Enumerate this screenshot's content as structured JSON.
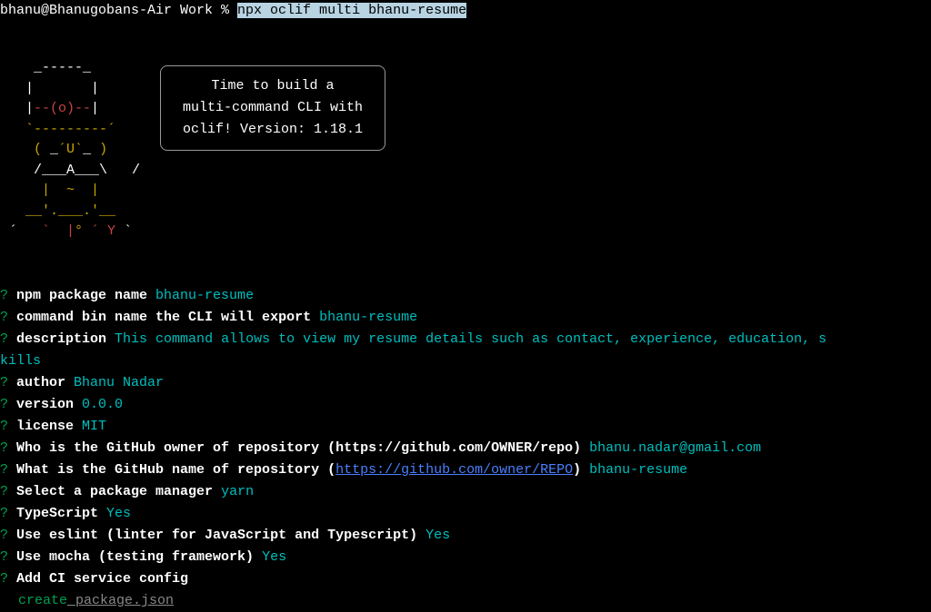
{
  "prompt": {
    "host": "bhanu@Bhanugobans-Air Work % ",
    "command": "npx oclif multi bhanu-resume"
  },
  "ascii": {
    "l1": "   _-----_     ",
    "l2a": "  |       |    ",
    "l2b": "",
    "l3a": "  |",
    "l3b": "--(o)--",
    "l3c": "|    ",
    "l4": "  `---------´   ",
    "l5a": "   ",
    "l5b": "( ",
    "l5c": "_",
    "l5d": "´U`",
    "l5e": "_",
    "l5f": " )",
    "l5g": "    ",
    "l6": "   /___A___\\   /",
    "l7a": "    ",
    "l7b": "|  ~  |",
    "l7c": "     ",
    "l8": "  __'.___.'__   ",
    "l9a": "´   ",
    "l9b": "`  |",
    "l9c": "° ",
    "l9d": "´ Y",
    "l9e": " ` "
  },
  "speech": {
    "line1": "Time to build a",
    "line2": "multi-command CLI with",
    "line3": "oclif! Version: 1.18.1"
  },
  "questions": {
    "mark": "?",
    "q1": {
      "text": " npm package name ",
      "answer": "bhanu-resume"
    },
    "q2": {
      "text": " command bin name the CLI will export ",
      "answer": "bhanu-resume"
    },
    "q3": {
      "text": " description ",
      "answer": "This command allows to view my resume details such as contact, experience, education, s"
    },
    "q3cont": "kills",
    "q4": {
      "text": " author ",
      "answer": "Bhanu Nadar"
    },
    "q5": {
      "text": " version ",
      "answer": "0.0.0"
    },
    "q6": {
      "text": " license ",
      "answer": "MIT"
    },
    "q7": {
      "text": " Who is the GitHub owner of repository (https://github.com/OWNER/repo) ",
      "answer": "bhanu.nadar@gmail.com"
    },
    "q8": {
      "text1": " What is the GitHub name of repository (",
      "link": "https://github.com/owner/REPO",
      "text2": ") ",
      "answer": "bhanu-resume"
    },
    "q9": {
      "text": " Select a package manager ",
      "answer": "yarn"
    },
    "q10": {
      "text": " TypeScript ",
      "answer": "Yes"
    },
    "q11": {
      "text": " Use eslint (linter for JavaScript and Typescript) ",
      "answer": "Yes"
    },
    "q12": {
      "text": " Use mocha (testing framework) ",
      "answer": "Yes"
    },
    "q13": {
      "text": " Add CI service config ",
      "answer": ""
    }
  },
  "create": {
    "word": "create",
    "file": " package.json"
  }
}
